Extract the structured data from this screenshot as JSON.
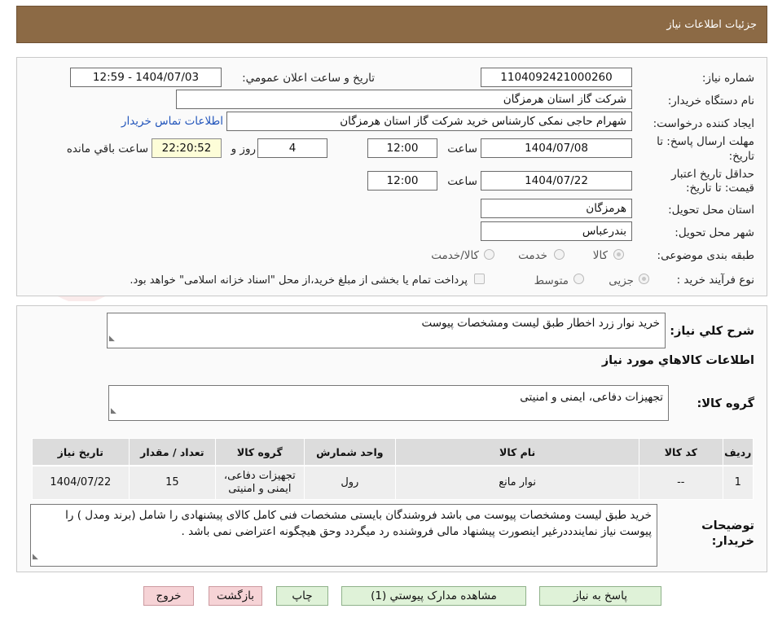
{
  "header": {
    "title": "جزئیات اطلاعات نیاز"
  },
  "watermark": {
    "text": "AriaTender.neT"
  },
  "fields": {
    "need_number_label": "شماره نیاز:",
    "need_number": "1104092421000260",
    "announce_label": "تاریخ و ساعت اعلان عمومي:",
    "announce_value": "1404/07/03 - 12:59",
    "buyer_org_label": "نام دستگاه خريدار:",
    "buyer_org": "شرکت گاز استان هرمزگان",
    "requester_label": "ايجاد کننده درخواست:",
    "requester": "شهرام حاجی نمکی کارشناس خرید شرکت گاز استان هرمزگان",
    "buyer_contact_link": "اطلاعات تماس خریدار",
    "deadline_label_1": "مهلت ارسال پاسخ: تا",
    "deadline_label_2": "تاریخ:",
    "deadline_date": "1404/07/08",
    "time_label": "ساعت",
    "deadline_time": "12:00",
    "days_value": "4",
    "days_label": "روز و",
    "remaining_time": "22:20:52",
    "remaining_label": "ساعت باقي مانده",
    "validity_label_1": "حداقل تاریخ اعتبار",
    "validity_label_2": "قیمت: تا تاریخ:",
    "validity_date": "1404/07/22",
    "validity_time": "12:00",
    "province_label": "استان محل تحویل:",
    "province": "هرمزگان",
    "city_label": "شهر محل تحویل:",
    "city": "بندرعباس",
    "category_label": "طبقه بندی موضوعی:",
    "category_options": [
      "کالا",
      "خدمت",
      "کالا/خدمت"
    ],
    "process_label": "نوع فرآیند خرید :",
    "process_options": [
      "جزیی",
      "متوسط"
    ],
    "payment_note": "پرداخت تمام یا بخشی از مبلغ خرید،از محل \"اسناد خزانه اسلامی\" خواهد بود."
  },
  "description": {
    "label": "شرح کلي نياز:",
    "value": "خرید نوار زرد اخطار طبق لیست ومشخصات پیوست"
  },
  "goods": {
    "section_title": "اطلاعات کالاهاي مورد نياز",
    "group_label": "گروه کالا:",
    "group_value": "تجهیزات دفاعی، ایمنی و امنیتی"
  },
  "table": {
    "headers": [
      "رديف",
      "کد کالا",
      "نام کالا",
      "واحد شمارش",
      "گروه کالا",
      "تعداد / مقدار",
      "تاريخ نياز"
    ],
    "rows": [
      [
        "1",
        "--",
        "نوار مانع",
        "رول",
        "تجهیزات دفاعی، ایمنی و امنیتی",
        "15",
        "1404/07/22"
      ]
    ]
  },
  "buyer_notes": {
    "label_1": "توضیحات",
    "label_2": "خریدار:",
    "value": "خرید طبق لیست ومشخصات پیوست می باشد فروشندگان بایستی مشخصات فنی کامل کالای پیشنهادی را شامل (برند ومدل ) را پیوست نیاز نمایندددرغیر اینصورت پیشنهاد مالی فروشنده رد میگردد وحق هیچگونه اعتراضی نمی باشد ."
  },
  "buttons": {
    "respond": "پاسخ به نياز",
    "attachments": "مشاهده مدارک پيوستي (1)",
    "print": "چاپ",
    "back": "بازگشت",
    "exit": "خروج"
  },
  "colors": {
    "header_bg": "#8c6a45",
    "link": "#2255bb",
    "button_green": "#dff2d8",
    "button_pink": "#f6d3d6",
    "remaining_bg": "#fdfdd8"
  }
}
